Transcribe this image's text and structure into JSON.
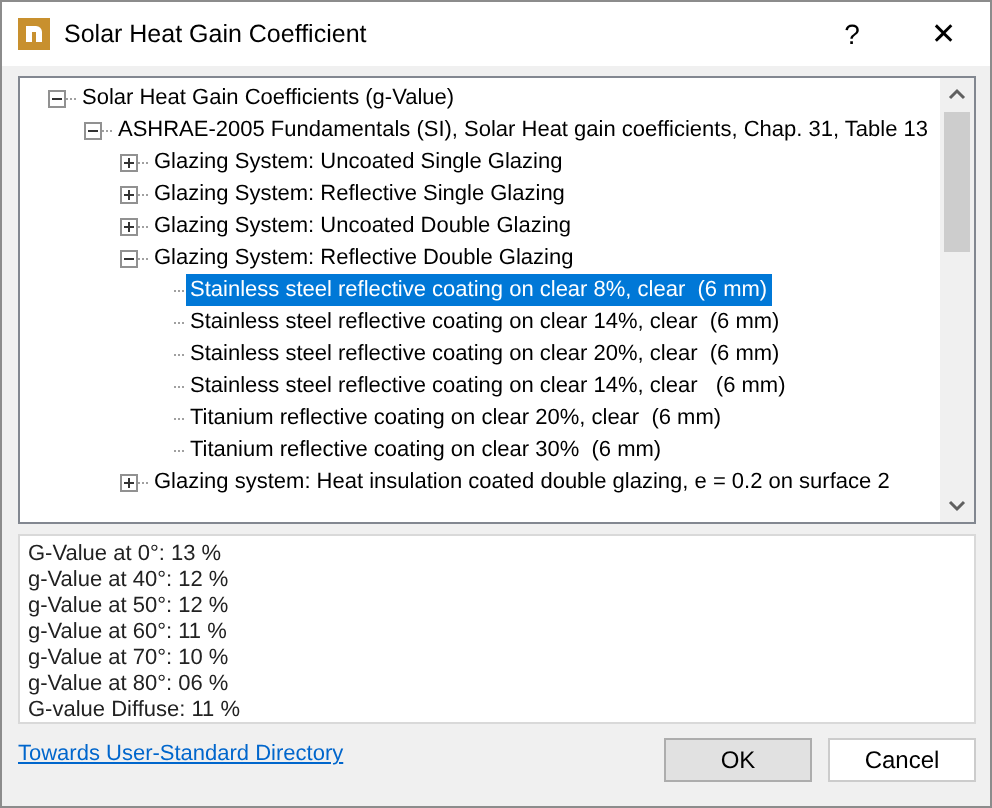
{
  "window": {
    "title": "Solar Heat Gain Coefficient",
    "help": "?",
    "close": "✕"
  },
  "tree": [
    {
      "label": "Solar Heat Gain Coefficients (g-Value)",
      "expanded": true,
      "selected": false,
      "children": [
        {
          "label": "ASHRAE-2005 Fundamentals (SI), Solar Heat gain coefficients, Chap. 31, Table 13",
          "expanded": true,
          "selected": false,
          "children": [
            {
              "label": "Glazing System: Uncoated Single Glazing",
              "expanded": false,
              "selected": false
            },
            {
              "label": "Glazing System: Reflective Single Glazing",
              "expanded": false,
              "selected": false
            },
            {
              "label": "Glazing System: Uncoated Double Glazing",
              "expanded": false,
              "selected": false
            },
            {
              "label": "Glazing System: Reflective Double Glazing",
              "expanded": true,
              "selected": false,
              "children": [
                {
                  "label": "Stainless steel reflective coating on clear 8%, clear  (6 mm)",
                  "selected": true
                },
                {
                  "label": "Stainless steel reflective coating on clear 14%, clear  (6 mm)",
                  "selected": false
                },
                {
                  "label": "Stainless steel reflective coating on clear 20%, clear  (6 mm)",
                  "selected": false
                },
                {
                  "label": "Stainless steel reflective coating on clear 14%, clear   (6 mm)",
                  "selected": false
                },
                {
                  "label": "Titanium reflective coating on clear 20%, clear  (6 mm)",
                  "selected": false
                },
                {
                  "label": "Titanium reflective coating on clear 30%  (6 mm)",
                  "selected": false
                }
              ]
            },
            {
              "label": "Glazing system: Heat insulation coated double glazing, e = 0.2 on surface 2",
              "expanded": false,
              "selected": false
            }
          ]
        }
      ]
    }
  ],
  "details": [
    "G-Value at 0°: 13 %",
    "g-Value at 40°: 12 %",
    "g-Value at 50°: 12 %",
    "g-Value at 60°: 11 %",
    "g-Value at 70°: 10 %",
    "g-Value at 80°: 06 %",
    "G-value Diffuse: 11 %"
  ],
  "link": "Towards User-Standard Directory",
  "buttons": [
    {
      "label": "OK",
      "default": true
    },
    {
      "label": "Cancel",
      "default": false
    }
  ]
}
